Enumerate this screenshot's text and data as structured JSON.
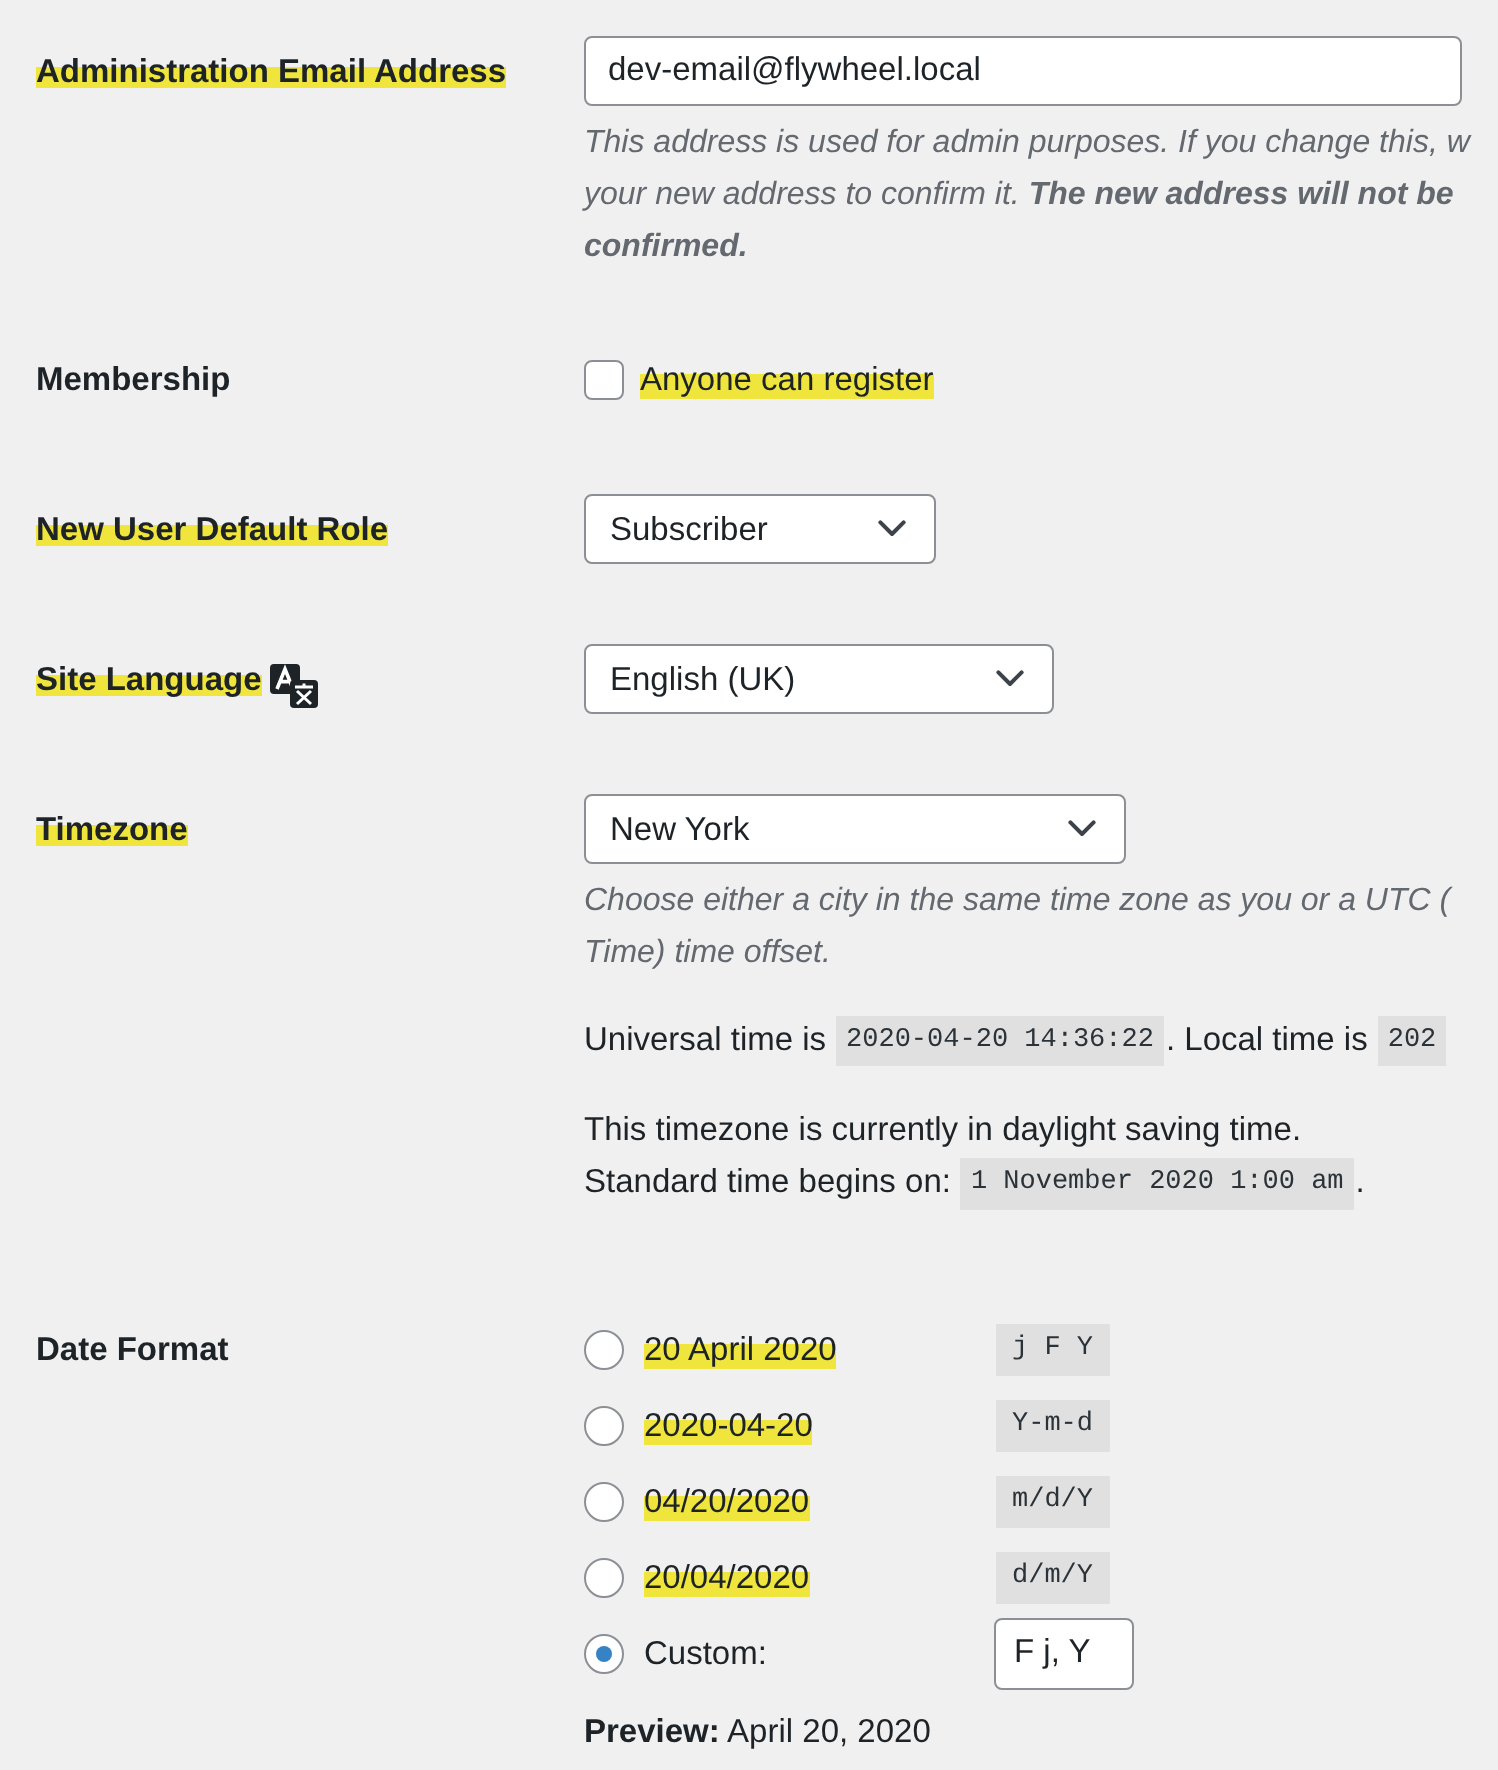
{
  "settings": [
    {
      "kind": "email",
      "label": "Administration Email Address",
      "highlighted": true,
      "value": "dev-email@flywheel.local",
      "description": [
        "This address is used for admin purposes. If you change this, w",
        "your new address to confirm it. **The new address will not be**",
        "**confirmed.**"
      ]
    },
    {
      "kind": "checkbox",
      "label": "Membership",
      "highlighted": false,
      "option": {
        "label": "Anyone can register",
        "checked": false,
        "highlighted": true
      }
    },
    {
      "kind": "select",
      "label": "New User Default Role",
      "highlighted": true,
      "value": "Subscriber"
    },
    {
      "kind": "language",
      "label": "Site Language",
      "highlighted": true,
      "value": "English (UK)"
    },
    {
      "kind": "timezone",
      "label": "Timezone",
      "highlighted": true,
      "value": "New York",
      "description": [
        "Choose either a city in the same time zone as you or a UTC (",
        "Time) time offset."
      ],
      "info": [
        {
          "lines": [
            [
              {
                "kind": "text",
                "text": "Universal time is"
              },
              {
                "kind": "code",
                "text": "2020-04-20 14:36:22"
              },
              {
                "kind": "text",
                "text": ". Local time is"
              },
              {
                "kind": "code",
                "text": "202"
              }
            ]
          ]
        },
        {
          "lines": [
            [
              {
                "kind": "text",
                "text": "This timezone is currently in daylight saving time."
              }
            ],
            [
              {
                "kind": "text",
                "text": "Standard time begins on:"
              },
              {
                "kind": "code",
                "text": "1 November 2020 1:00 am"
              },
              {
                "kind": "text",
                "text": "."
              }
            ]
          ]
        }
      ]
    },
    {
      "kind": "date_format",
      "label": "Date Format",
      "highlighted": false,
      "options": [
        {
          "kind": "preset",
          "label": "20 April 2020",
          "code": "j F Y",
          "selected": false,
          "highlighted": true
        },
        {
          "kind": "preset",
          "label": "2020-04-20",
          "code": "Y-m-d",
          "selected": false,
          "highlighted": true
        },
        {
          "kind": "preset",
          "label": "04/20/2020",
          "code": "m/d/Y",
          "selected": false,
          "highlighted": true
        },
        {
          "kind": "preset",
          "label": "20/04/2020",
          "code": "d/m/Y",
          "selected": false,
          "highlighted": true
        },
        {
          "kind": "custom",
          "label": "Custom:",
          "value": "F j, Y",
          "selected": true,
          "highlighted": false
        }
      ],
      "preview": "**Preview:** April 20, 2020"
    }
  ]
}
